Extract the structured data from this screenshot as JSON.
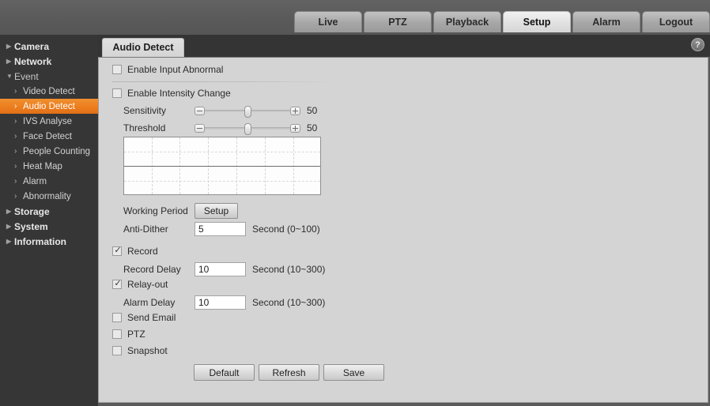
{
  "nav": {
    "tabs": [
      {
        "label": "Live",
        "active": false
      },
      {
        "label": "PTZ",
        "active": false
      },
      {
        "label": "Playback",
        "active": false
      },
      {
        "label": "Setup",
        "active": true
      },
      {
        "label": "Alarm",
        "active": false
      },
      {
        "label": "Logout",
        "active": false
      }
    ]
  },
  "sidebar": {
    "groups": [
      {
        "label": "Camera",
        "expanded": false
      },
      {
        "label": "Network",
        "expanded": false
      },
      {
        "label": "Event",
        "expanded": true
      },
      {
        "label": "Storage",
        "expanded": false
      },
      {
        "label": "System",
        "expanded": false
      },
      {
        "label": "Information",
        "expanded": false
      }
    ],
    "event_items": [
      {
        "label": "Video Detect",
        "selected": false
      },
      {
        "label": "Audio Detect",
        "selected": true
      },
      {
        "label": "IVS Analyse",
        "selected": false
      },
      {
        "label": "Face Detect",
        "selected": false
      },
      {
        "label": "People Counting",
        "selected": false
      },
      {
        "label": "Heat Map",
        "selected": false
      },
      {
        "label": "Alarm",
        "selected": false
      },
      {
        "label": "Abnormality",
        "selected": false
      }
    ],
    "highlight_color": "#ec7c1b"
  },
  "page": {
    "tab_label": "Audio Detect",
    "help_glyph": "?"
  },
  "form": {
    "enable_input_abnormal": {
      "label": "Enable Input Abnormal",
      "checked": false
    },
    "enable_intensity_change": {
      "label": "Enable Intensity Change",
      "checked": false
    },
    "sensitivity": {
      "label": "Sensitivity",
      "value": "50",
      "percent": 50
    },
    "threshold": {
      "label": "Threshold",
      "value": "50",
      "percent": 50
    },
    "working_period": {
      "label": "Working Period",
      "button": "Setup"
    },
    "anti_dither": {
      "label": "Anti-Dither",
      "value": "5",
      "unit": "Second (0~100)"
    },
    "record": {
      "label": "Record",
      "checked": true
    },
    "record_delay": {
      "label": "Record Delay",
      "value": "10",
      "unit": "Second (10~300)"
    },
    "relay_out": {
      "label": "Relay-out",
      "checked": true
    },
    "alarm_delay": {
      "label": "Alarm Delay",
      "value": "10",
      "unit": "Second (10~300)"
    },
    "send_email": {
      "label": "Send Email",
      "checked": false
    },
    "ptz": {
      "label": "PTZ",
      "checked": false
    },
    "snapshot": {
      "label": "Snapshot",
      "checked": false
    },
    "buttons": {
      "default": "Default",
      "refresh": "Refresh",
      "save": "Save"
    }
  }
}
